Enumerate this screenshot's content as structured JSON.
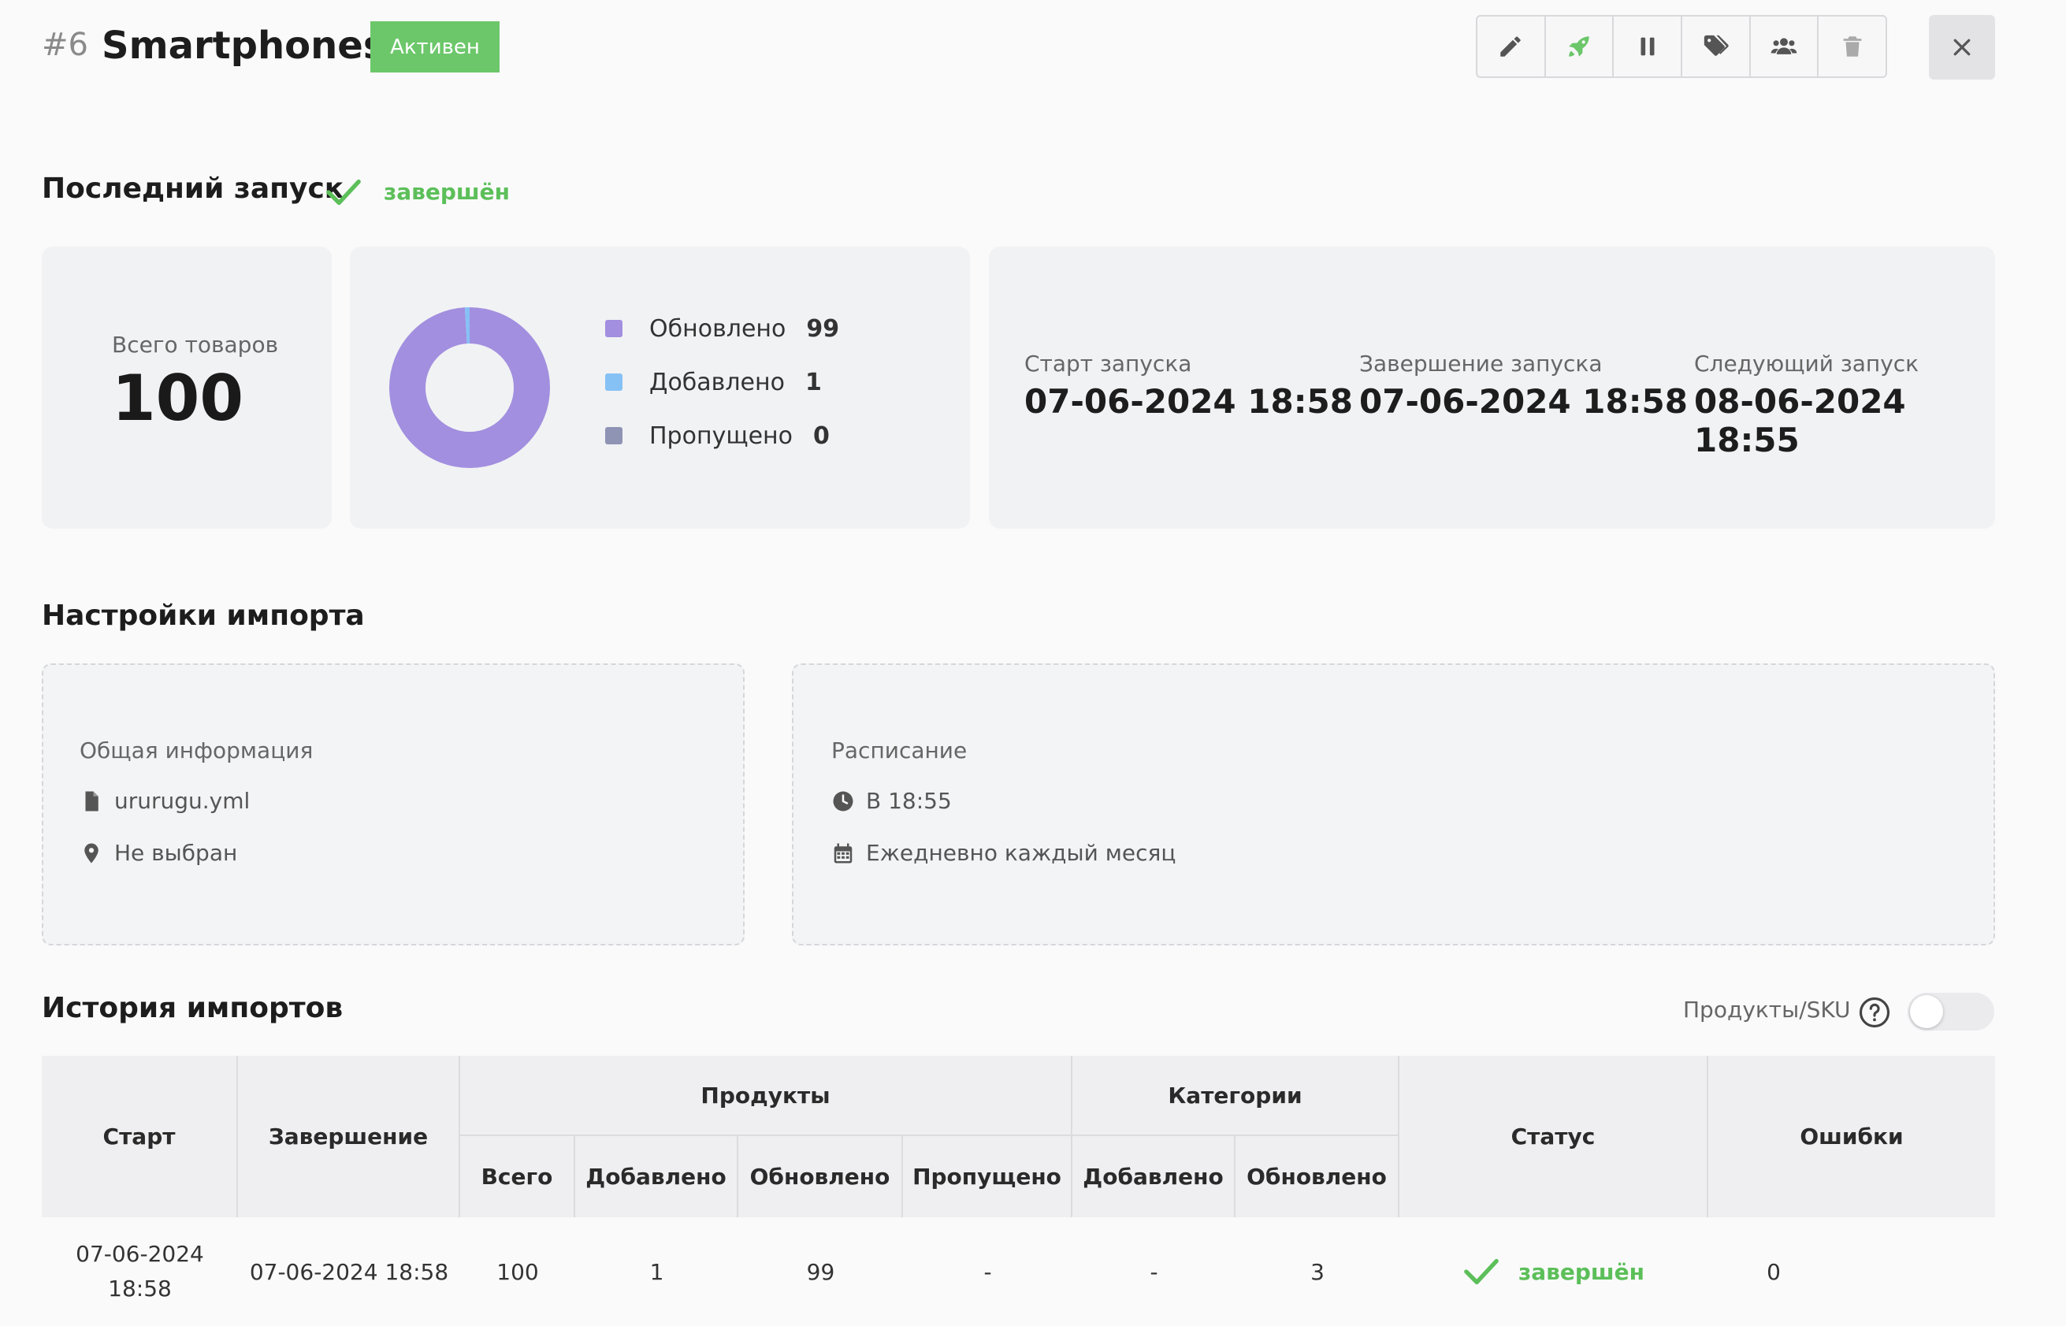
{
  "header": {
    "id": "#6",
    "title": "Smartphones",
    "badge": "Активен",
    "toolbar_icons": [
      "pencil-icon",
      "rocket-icon",
      "pause-icon",
      "tags-icon",
      "users-icon",
      "trash-icon"
    ],
    "close_icon": "close-icon"
  },
  "last_run": {
    "title": "Последний запуск",
    "status": "завершён",
    "total_label": "Всего товаров",
    "total_value": "100",
    "legend": [
      {
        "label": "Обновлено",
        "value": "99",
        "color": "#a28fdf"
      },
      {
        "label": "Добавлено",
        "value": "1",
        "color": "#86c1f5"
      },
      {
        "label": "Пропущено",
        "value": "0",
        "color": "#8f93b4"
      }
    ],
    "start_label": "Старт запуска",
    "start_value": "07-06-2024 18:58",
    "end_label": "Завершение запуска",
    "end_value": "07-06-2024 18:58",
    "next_label": "Следующий запуск",
    "next_value": "08-06-2024 18:55"
  },
  "chart_data": {
    "type": "pie",
    "categories": [
      "Обновлено",
      "Добавлено",
      "Пропущено"
    ],
    "values": [
      99,
      1,
      0
    ],
    "colors": [
      "#a28fdf",
      "#86c1f5",
      "#8f93b4"
    ]
  },
  "settings": {
    "title": "Настройки импорта",
    "general_title": "Общая информация",
    "file": "ururugu.yml",
    "location": "Не выбран",
    "schedule_title": "Расписание",
    "time": "В 18:55",
    "recurrence": "Ежедневно каждый месяц"
  },
  "history": {
    "title": "История импортов",
    "toggle_label": "Продукты/SKU",
    "help_icon": "help-icon",
    "headers": {
      "start": "Старт",
      "end": "Завершение",
      "products": "Продукты",
      "categories": "Категории",
      "status": "Статус",
      "errors": "Ошибки",
      "total": "Всего",
      "added": "Добавлено",
      "updated": "Обновлено",
      "skipped": "Пропущено",
      "cat_added": "Добавлено",
      "cat_updated": "Обновлено"
    },
    "rows": [
      {
        "start_date": "07-06-2024",
        "start_time": "18:58",
        "end": "07-06-2024 18:58",
        "total": "100",
        "added": "1",
        "updated": "99",
        "skipped": "-",
        "cat_added": "-",
        "cat_updated": "3",
        "status": "завершён",
        "errors": "0"
      }
    ]
  },
  "colors": {
    "accent_green": "#6cc76a",
    "status_green": "#5cbf59",
    "chart_updated": "#a28fdf",
    "chart_added": "#86c1f5",
    "chart_skipped": "#8f93b4"
  }
}
